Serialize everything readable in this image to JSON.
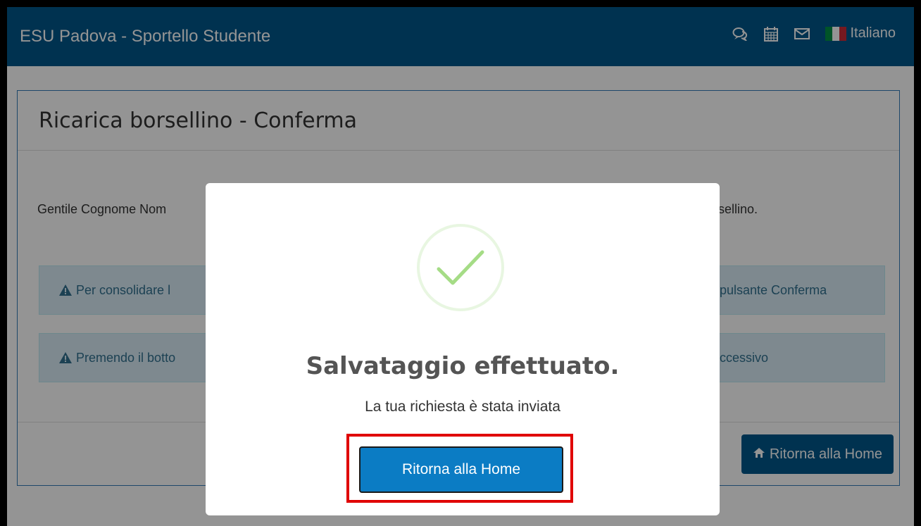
{
  "navbar": {
    "brand": "ESU Padova - Sportello Studente",
    "icons": [
      "comments-icon",
      "calendar-icon",
      "envelope-icon"
    ],
    "language": "Italiano"
  },
  "panel": {
    "title": "Ricarica borsellino - Conferma",
    "greeting_left": "Gentile Cognome Nom",
    "greeting_right": "sellino.",
    "alerts": [
      {
        "left": "Per consolidare l",
        "right": "pulsante Conferma"
      },
      {
        "left": "Premendo il botto",
        "right": "ccessivo"
      }
    ],
    "home_button": "Ritorna alla Home"
  },
  "modal": {
    "title": "Salvataggio effettuato.",
    "subtitle": "La tua richiesta è stata inviata",
    "button": "Ritorna alla Home"
  },
  "colors": {
    "navbar": "#00578a",
    "button": "#0b7cc4",
    "success": "#a5dc86",
    "highlight": "#e00000"
  }
}
